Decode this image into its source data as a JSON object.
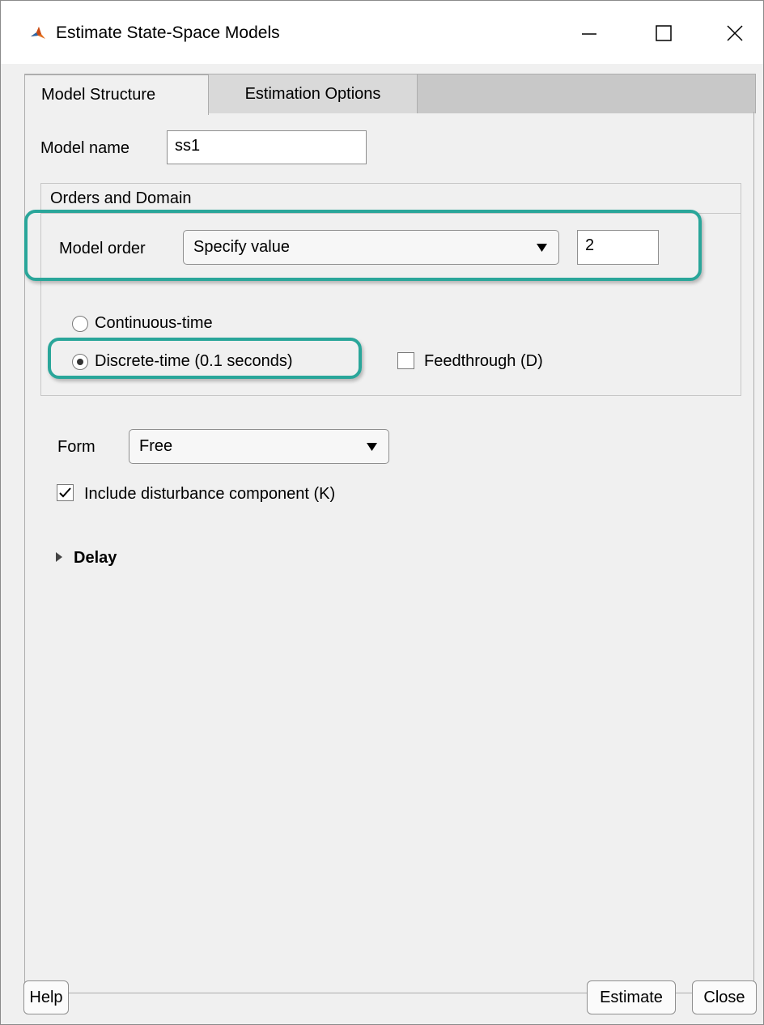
{
  "window": {
    "title": "Estimate State-Space Models"
  },
  "tabs": [
    {
      "label": "Model Structure",
      "active": true
    },
    {
      "label": "Estimation Options",
      "active": false
    }
  ],
  "model_name": {
    "label": "Model name",
    "value": "ss1"
  },
  "orders_domain": {
    "title": "Orders and Domain",
    "model_order_label": "Model order",
    "model_order_selected": "Specify value",
    "model_order_value": "2",
    "continuous_label": "Continuous-time",
    "discrete_label": "Discrete-time (0.1 seconds)",
    "selected_time_domain": "discrete",
    "feedthrough_label": "Feedthrough (D)",
    "feedthrough_checked": false
  },
  "form": {
    "label": "Form",
    "selected": "Free"
  },
  "disturbance": {
    "label": "Include disturbance component (K)",
    "checked": true
  },
  "delay": {
    "label": "Delay",
    "expanded": false
  },
  "buttons": {
    "help": "Help",
    "estimate": "Estimate",
    "close": "Close"
  },
  "colors": {
    "highlight": "#2aa69a"
  }
}
